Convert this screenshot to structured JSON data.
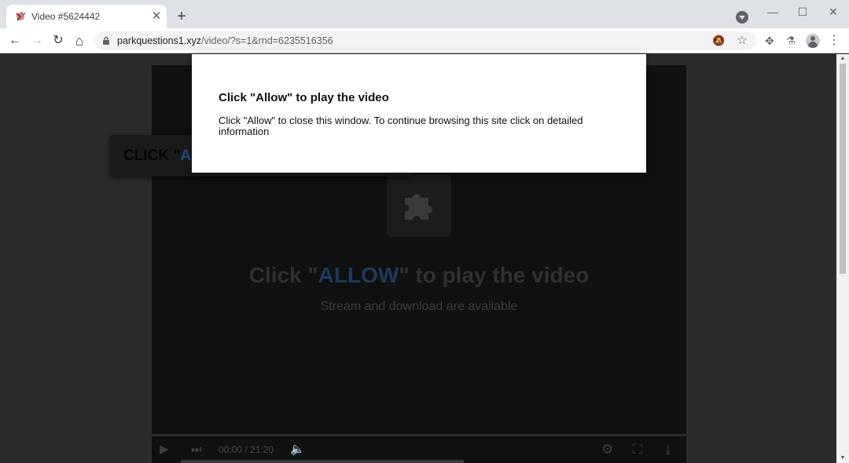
{
  "browser": {
    "tab": {
      "title": "Video #5624442",
      "close_glyph": "✕"
    },
    "new_tab_glyph": "+",
    "window_controls": {
      "minimize": "—",
      "maximize": "☐",
      "close": "✕"
    },
    "url": {
      "host": "parkquestions1.xyz",
      "path": "/video/?s=1&rnd=6235516356"
    },
    "icons": {
      "back": "arrow-left-icon",
      "forward": "arrow-right-icon",
      "reload": "reload-icon",
      "home": "home-icon",
      "lock": "lock-icon",
      "notifications_blocked": "bell-off-icon",
      "bookmark": "star-icon",
      "extensions": "puzzle-icon",
      "labs": "flask-icon",
      "profile": "avatar-icon",
      "menu": "kebab-menu-icon"
    },
    "glyphs": {
      "back": "←",
      "forward": "→",
      "reload": "↻",
      "home": "⌂",
      "bell_off": "🔕",
      "star": "☆",
      "extensions": "✥",
      "labs": "⚗",
      "menu": "⋮"
    }
  },
  "dialog": {
    "title": "Click \"Allow\" to play the video",
    "body": "Click \"Allow\" to close this window. To continue browsing this site click on detailed information"
  },
  "banner": {
    "prefix": "CLICK \"",
    "allow": "A"
  },
  "player": {
    "headline_prefix": "Click \"",
    "headline_allow": "ALLOW",
    "headline_suffix": "\" to play the video",
    "subline": "Stream and download are available",
    "timecode": "00:00 / 21:20",
    "glyphs": {
      "play": "▶",
      "next": "⏭",
      "volume": "🔈",
      "settings": "⚙",
      "fullscreen": "⛶",
      "download": "⤓"
    }
  },
  "colors": {
    "allow_blue": "#1b3b5c",
    "page_bg": "#2b2b2b",
    "player_bg": "#101010"
  }
}
